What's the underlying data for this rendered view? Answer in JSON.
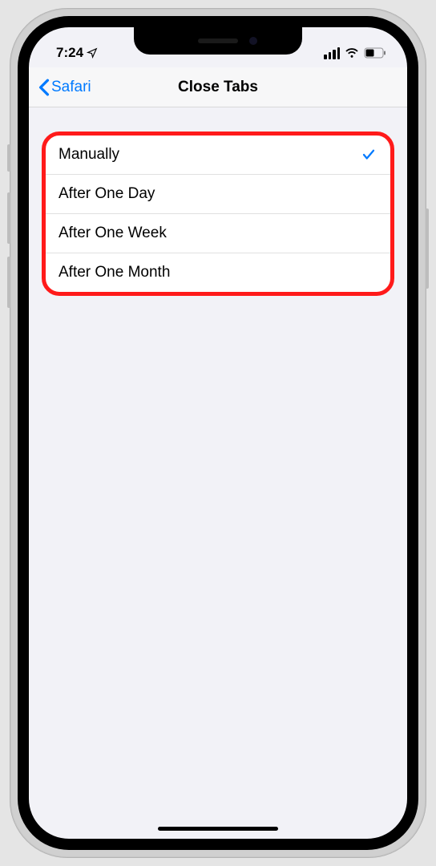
{
  "status": {
    "time": "7:24"
  },
  "nav": {
    "back_label": "Safari",
    "title": "Close Tabs"
  },
  "options": [
    {
      "label": "Manually",
      "selected": true
    },
    {
      "label": "After One Day",
      "selected": false
    },
    {
      "label": "After One Week",
      "selected": false
    },
    {
      "label": "After One Month",
      "selected": false
    }
  ]
}
